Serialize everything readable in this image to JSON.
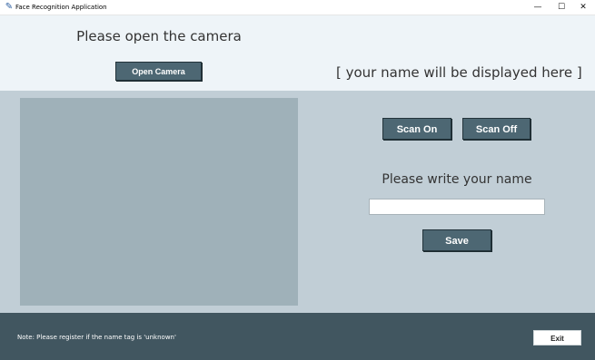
{
  "window": {
    "title": "Face Recognition Application",
    "icon": "feather-icon",
    "controls": {
      "minimize": "—",
      "maximize": "☐",
      "close": "✕"
    }
  },
  "top": {
    "camera_prompt": "Please open the camera",
    "open_camera_label": "Open Camera",
    "name_display": "[ your name will be displayed here ]"
  },
  "middle": {
    "scan_on_label": "Scan On",
    "scan_off_label": "Scan Off",
    "name_prompt": "Please write your name",
    "name_value": "",
    "save_label": "Save"
  },
  "bottom": {
    "note": "Note: Please register if the name tag is  'unknown'",
    "exit_label": "Exit"
  },
  "colors": {
    "top_bg": "#eef4f8",
    "middle_bg": "#c1ced6",
    "bottom_bg": "#415660",
    "button_bg": "#4d6773",
    "camera_view_bg": "#9fb1b9"
  }
}
